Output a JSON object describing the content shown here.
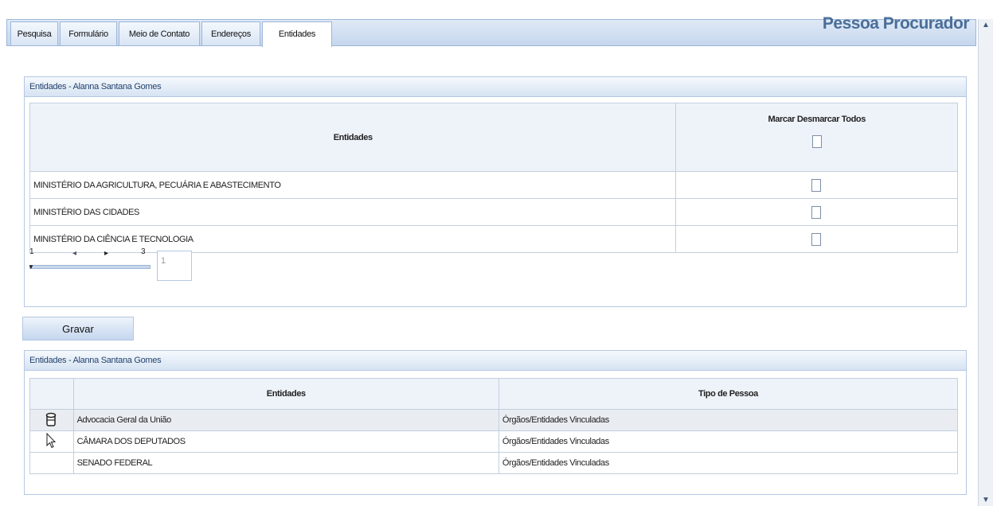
{
  "page_title": "Pessoa Procurador",
  "tabs": [
    {
      "label": "Pesquisa"
    },
    {
      "label": "Formulário"
    },
    {
      "label": "Meio de Contato"
    },
    {
      "label": "Endereços"
    },
    {
      "label": "Entidades",
      "active": true
    }
  ],
  "panel1": {
    "header": "Entidades - Alanna Santana   Gomes",
    "col_entidades": "Entidades",
    "col_marcar": "Marcar Desmarcar Todos",
    "rows": [
      {
        "name": "MINISTÉRIO DA AGRICULTURA, PECUÁRIA E ABASTECIMENTO"
      },
      {
        "name": "MINISTÉRIO DAS CIDADES"
      },
      {
        "name": "MINISTÉRIO DA CIÊNCIA E TECNOLOGIA"
      }
    ],
    "pager": {
      "first": "1",
      "last": "3",
      "current": "1"
    }
  },
  "gravar_label": "Gravar",
  "panel2": {
    "header": "Entidades - Alanna Santana   Gomes",
    "col_entidades": "Entidades",
    "col_tipo": "Tipo de Pessoa",
    "rows": [
      {
        "name": "Advocacia Geral da União",
        "tipo": "Órgãos/Entidades Vinculadas"
      },
      {
        "name": "CÂMARA DOS DEPUTADOS",
        "tipo": "Órgãos/Entidades Vinculadas"
      },
      {
        "name": "SENADO FEDERAL",
        "tipo": "Órgãos/Entidades Vinculadas"
      }
    ]
  },
  "colors": {
    "accent": "#4a6e99",
    "header_bg": "#d6e3f3",
    "border": "#b4c8e2"
  },
  "icons": [
    "trash-icon",
    "cursor-icon",
    "checkbox-icon",
    "scroll-up-icon",
    "scroll-down-icon"
  ]
}
